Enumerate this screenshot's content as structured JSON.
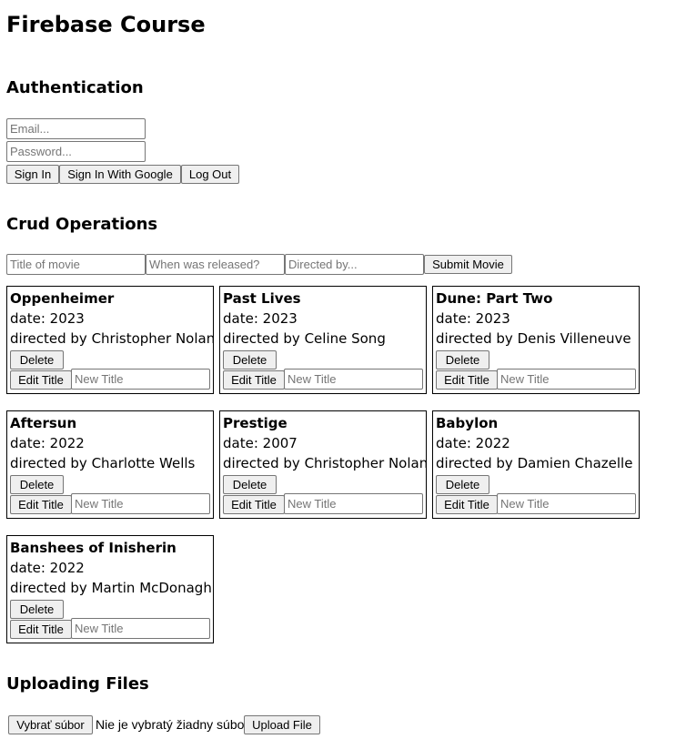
{
  "page_title": "Firebase Course",
  "auth": {
    "heading": "Authentication",
    "email_placeholder": "Email...",
    "password_placeholder": "Password...",
    "sign_in_label": "Sign In",
    "sign_in_google_label": "Sign In With Google",
    "log_out_label": "Log Out"
  },
  "crud": {
    "heading": "Crud Operations",
    "title_placeholder": "Title of movie",
    "release_placeholder": "When was released?",
    "director_placeholder": "Directed by...",
    "submit_label": "Submit Movie"
  },
  "movies": [
    {
      "title": "Oppenheimer",
      "date": "date: 2023",
      "director": "directed by Christopher Nolan"
    },
    {
      "title": "Past Lives",
      "date": "date: 2023",
      "director": "directed by Celine Song"
    },
    {
      "title": "Dune: Part Two",
      "date": "date: 2023",
      "director": "directed by Denis Villeneuve"
    },
    {
      "title": "Aftersun",
      "date": "date: 2022",
      "director": "directed by Charlotte Wells"
    },
    {
      "title": "Prestige",
      "date": "date: 2007",
      "director": "directed by Christopher Nolan"
    },
    {
      "title": "Babylon",
      "date": "date: 2022",
      "director": "directed by Damien Chazelle"
    },
    {
      "title": "Banshees of Inisherin",
      "date": "date: 2022",
      "director": "directed by Martin McDonagh"
    }
  ],
  "movie_card": {
    "delete_label": "Delete",
    "edit_label": "Edit Title",
    "new_title_placeholder": "New Title"
  },
  "upload": {
    "heading": "Uploading Files",
    "choose_file_label": "Vybrať súbor",
    "no_file_text": "Nie je vybratý žiadny súbor",
    "upload_label": "Upload File"
  }
}
